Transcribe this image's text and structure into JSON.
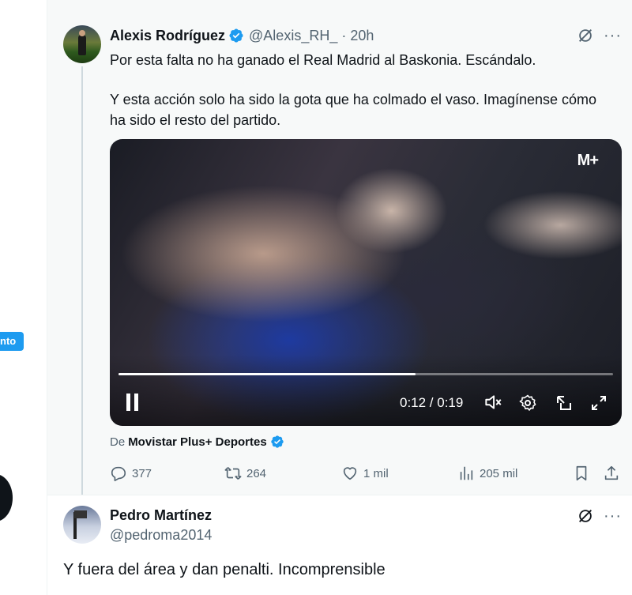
{
  "sidebar": {
    "pill_label": "nto"
  },
  "tweet": {
    "author_name": "Alexis Rodríguez",
    "handle": "@Alexis_RH_",
    "separator": "·",
    "time": "20h",
    "text_paragraphs": [
      "Por esta falta no ha ganado el Real Madrid al Baskonia. Escándalo.",
      "Y esta acción solo ha sido la gota que ha colmado el vaso. Imagínense cómo ha sido el resto del partido."
    ],
    "video": {
      "broadcaster_logo": "M+",
      "current_time": "0:12",
      "duration": "0:19",
      "time_readout": "0:12 / 0:19",
      "progress_fraction": 0.6
    },
    "source_prefix": "De",
    "source_name": "Movistar Plus+ Deportes",
    "replies": "377",
    "retweets": "264",
    "likes": "1 mil",
    "views": "205 mil",
    "more_glyph": "···"
  },
  "reply": {
    "author_name": "Pedro Martínez",
    "handle": "@pedroma2014",
    "text": "Y fuera del área y dan penalti. Incomprensible",
    "more_glyph": "···"
  },
  "colors": {
    "accent": "#1d9bf0",
    "muted": "#536471",
    "text": "#0f1419",
    "hover_bg": "#f7f9f9"
  }
}
